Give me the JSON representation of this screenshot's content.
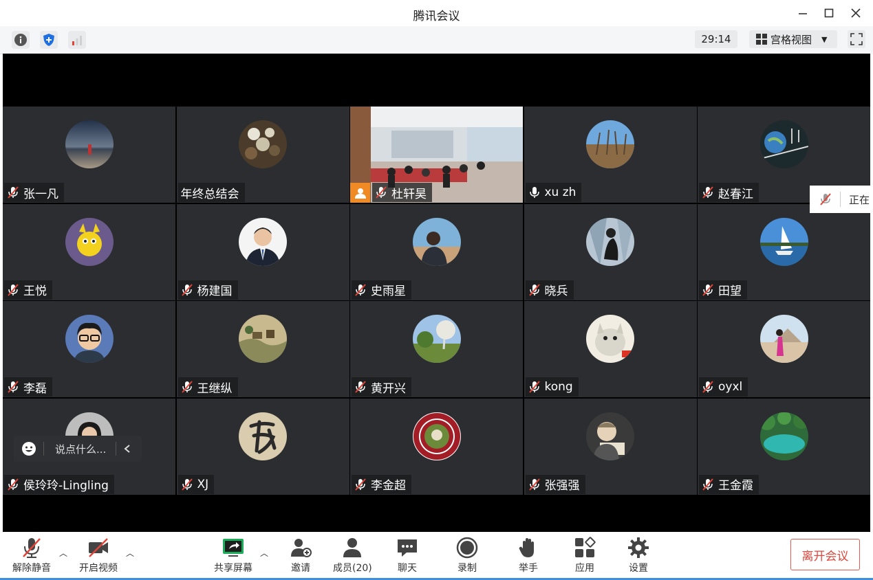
{
  "window": {
    "title": "腾讯会议"
  },
  "toolbar": {
    "timer": "29:14",
    "view_label": "宫格视图"
  },
  "participants": [
    {
      "name": "张一凡",
      "muted": true
    },
    {
      "name": "年终总结会",
      "muted": false,
      "no_icon": true
    },
    {
      "name": "杜轩昊",
      "muted": true,
      "video": true
    },
    {
      "name": "xu zh",
      "muted": false
    },
    {
      "name": "赵春江",
      "muted": true
    },
    {
      "name": "王悦",
      "muted": true
    },
    {
      "name": "杨建国",
      "muted": true
    },
    {
      "name": "史雨星",
      "muted": true
    },
    {
      "name": "晓兵",
      "muted": true
    },
    {
      "name": "田望",
      "muted": true
    },
    {
      "name": "李磊",
      "muted": true
    },
    {
      "name": "王继纵",
      "muted": true
    },
    {
      "name": "黄开兴",
      "muted": true
    },
    {
      "name": "kong",
      "muted": true
    },
    {
      "name": "oyxl",
      "muted": true
    },
    {
      "name": "侯玲玲-Lingling",
      "muted": true
    },
    {
      "name": "XJ",
      "muted": true
    },
    {
      "name": "李金超",
      "muted": true
    },
    {
      "name": "张强强",
      "muted": true
    },
    {
      "name": "王金霞",
      "muted": true
    }
  ],
  "chat_popup": {
    "placeholder": "说点什么..."
  },
  "side_peek": {
    "text": "正在"
  },
  "bottom": {
    "unmute": "解除静音",
    "start_video": "开启视频",
    "share_screen": "共享屏幕",
    "invite": "邀请",
    "members": "成员(20)",
    "chat": "聊天",
    "record": "录制",
    "raise_hand": "举手",
    "apps": "应用",
    "settings": "设置",
    "leave": "离开会议"
  },
  "colors": {
    "tile_bg": "#2b2d30",
    "leave_red": "#e0453a",
    "share_green": "#1aad5a",
    "mute_red": "#e0453a"
  }
}
